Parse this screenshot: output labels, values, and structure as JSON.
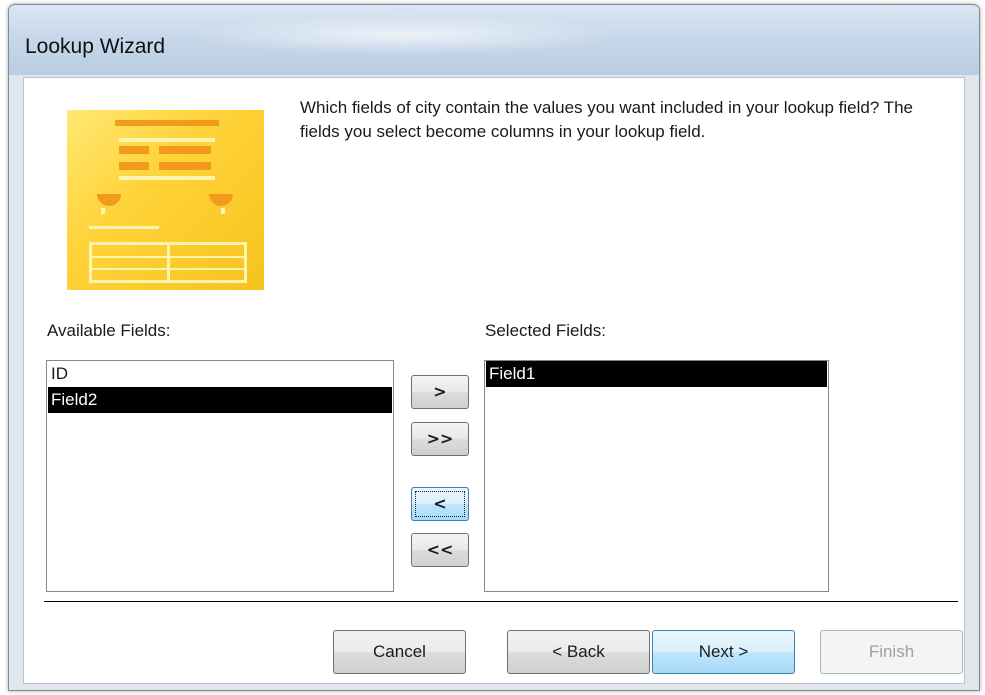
{
  "window": {
    "title": "Lookup Wizard"
  },
  "prompt": "Which fields of city contain the values you want included in your lookup field? The fields you select become columns in your lookup field.",
  "available": {
    "label": "Available Fields:",
    "items": [
      {
        "label": "ID",
        "selected": false
      },
      {
        "label": "Field2",
        "selected": true
      }
    ]
  },
  "selected_fields": {
    "label": "Selected Fields:",
    "items": [
      {
        "label": "Field1",
        "selected": true
      }
    ]
  },
  "move_buttons": {
    "add_one": ">",
    "add_all": ">>",
    "remove_one": "<",
    "remove_all": "<<"
  },
  "footer": {
    "cancel": "Cancel",
    "back": "< Back",
    "next": "Next >",
    "finish": "Finish"
  },
  "colors": {
    "selection": "#000000",
    "wizard_image": "#ffd339",
    "title_bar": "#c8d8ea"
  }
}
